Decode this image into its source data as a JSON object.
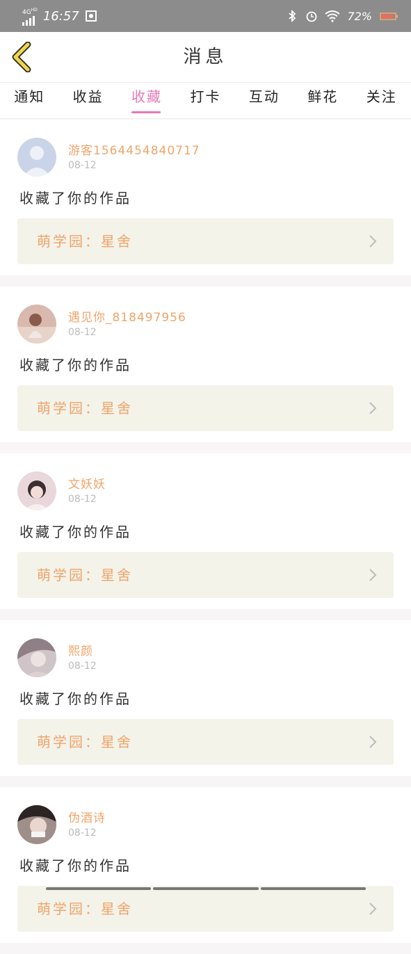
{
  "status_bar": {
    "network": "4G",
    "network_sup": "HD",
    "time": "16:57",
    "battery": "72%"
  },
  "header": {
    "title": "消息",
    "back_icon": "chevron-left-icon"
  },
  "tabs": [
    {
      "label": "通知",
      "active": false
    },
    {
      "label": "收益",
      "active": false
    },
    {
      "label": "收藏",
      "active": true
    },
    {
      "label": "打卡",
      "active": false
    },
    {
      "label": "互动",
      "active": false
    },
    {
      "label": "鲜花",
      "active": false
    },
    {
      "label": "关注",
      "active": false
    }
  ],
  "colors": {
    "accent": "#e878b7",
    "name": "#f0a469",
    "card_target_bg": "#f3f3ea",
    "back_arrow": "#f2d64a"
  },
  "messages": [
    {
      "name": "游客1564454840717",
      "date": "08-12",
      "action": "收藏了你的作品",
      "target": "萌学园：星舍"
    },
    {
      "name": "遇见你_818497956",
      "date": "08-12",
      "action": "收藏了你的作品",
      "target": "萌学园：星舍"
    },
    {
      "name": "文妖妖",
      "date": "08-12",
      "action": "收藏了你的作品",
      "target": "萌学园：星舍"
    },
    {
      "name": "熙颜",
      "date": "08-12",
      "action": "收藏了你的作品",
      "target": "萌学园：星舍"
    },
    {
      "name": "伪酒诗",
      "date": "08-12",
      "action": "收藏了你的作品",
      "target": "萌学园：星舍"
    }
  ]
}
